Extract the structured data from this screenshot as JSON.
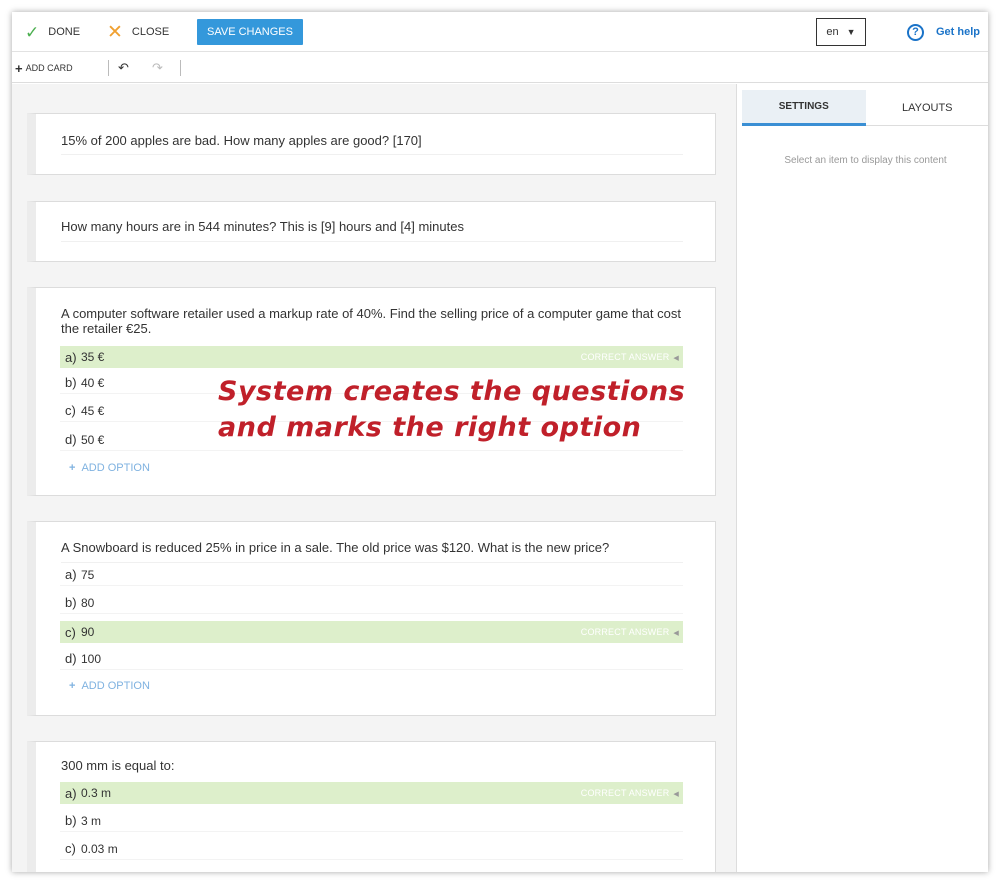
{
  "toolbar": {
    "done_label": "DONE",
    "close_label": "CLOSE",
    "save_label": "SAVE CHANGES",
    "language": "en",
    "help_label": "Get help",
    "add_card_label": "ADD CARD"
  },
  "icons": {
    "done": "check-icon",
    "close": "x-icon",
    "help": "question-circle-icon",
    "undo": "undo-icon",
    "redo": "redo-icon",
    "add": "plus-icon"
  },
  "colors": {
    "accent": "#3498db",
    "correct_highlight": "#ddefcb",
    "done_icon": "#4caf50",
    "close_icon": "#f0a030",
    "annotation": "#c0202a"
  },
  "cards": [
    {
      "question": "15% of 200 apples are bad. How many apples are good?  [170]"
    },
    {
      "question": "How many hours are in 544 minutes?  This is [9] hours and [4] minutes"
    },
    {
      "question": "A computer software retailer used a markup rate of 40%. Find the selling price of a computer game that cost the retailer €25.",
      "options": [
        {
          "label": "a)",
          "value": "35 €",
          "correct": true
        },
        {
          "label": "b)",
          "value": "40 €"
        },
        {
          "label": "c)",
          "value": "45 €"
        },
        {
          "label": "d)",
          "value": "50 €"
        }
      ],
      "add_option": "ADD OPTION"
    },
    {
      "question": "A Snowboard is reduced 25% in price in a sale. The old price was $120. What is the new price?",
      "options": [
        {
          "label": "a)",
          "value": "75"
        },
        {
          "label": "b)",
          "value": "80"
        },
        {
          "label": "c)",
          "value": "90",
          "correct": true
        },
        {
          "label": "d)",
          "value": "100"
        }
      ],
      "add_option": "ADD OPTION"
    },
    {
      "question": "300 mm is equal to:",
      "options": [
        {
          "label": "a)",
          "value": "0.3 m",
          "correct": true
        },
        {
          "label": "b)",
          "value": "3 m"
        },
        {
          "label": "c)",
          "value": "0.03 m"
        }
      ]
    }
  ],
  "correct_answer_label": "CORRECT ANSWER",
  "annotation": {
    "line1": "System creates the questions",
    "line2": "and marks the right option"
  },
  "sidebar": {
    "tabs": [
      {
        "label": "SETTINGS",
        "active": true
      },
      {
        "label": "LAYOUTS",
        "active": false
      }
    ],
    "message": "Select an item to display this content"
  }
}
